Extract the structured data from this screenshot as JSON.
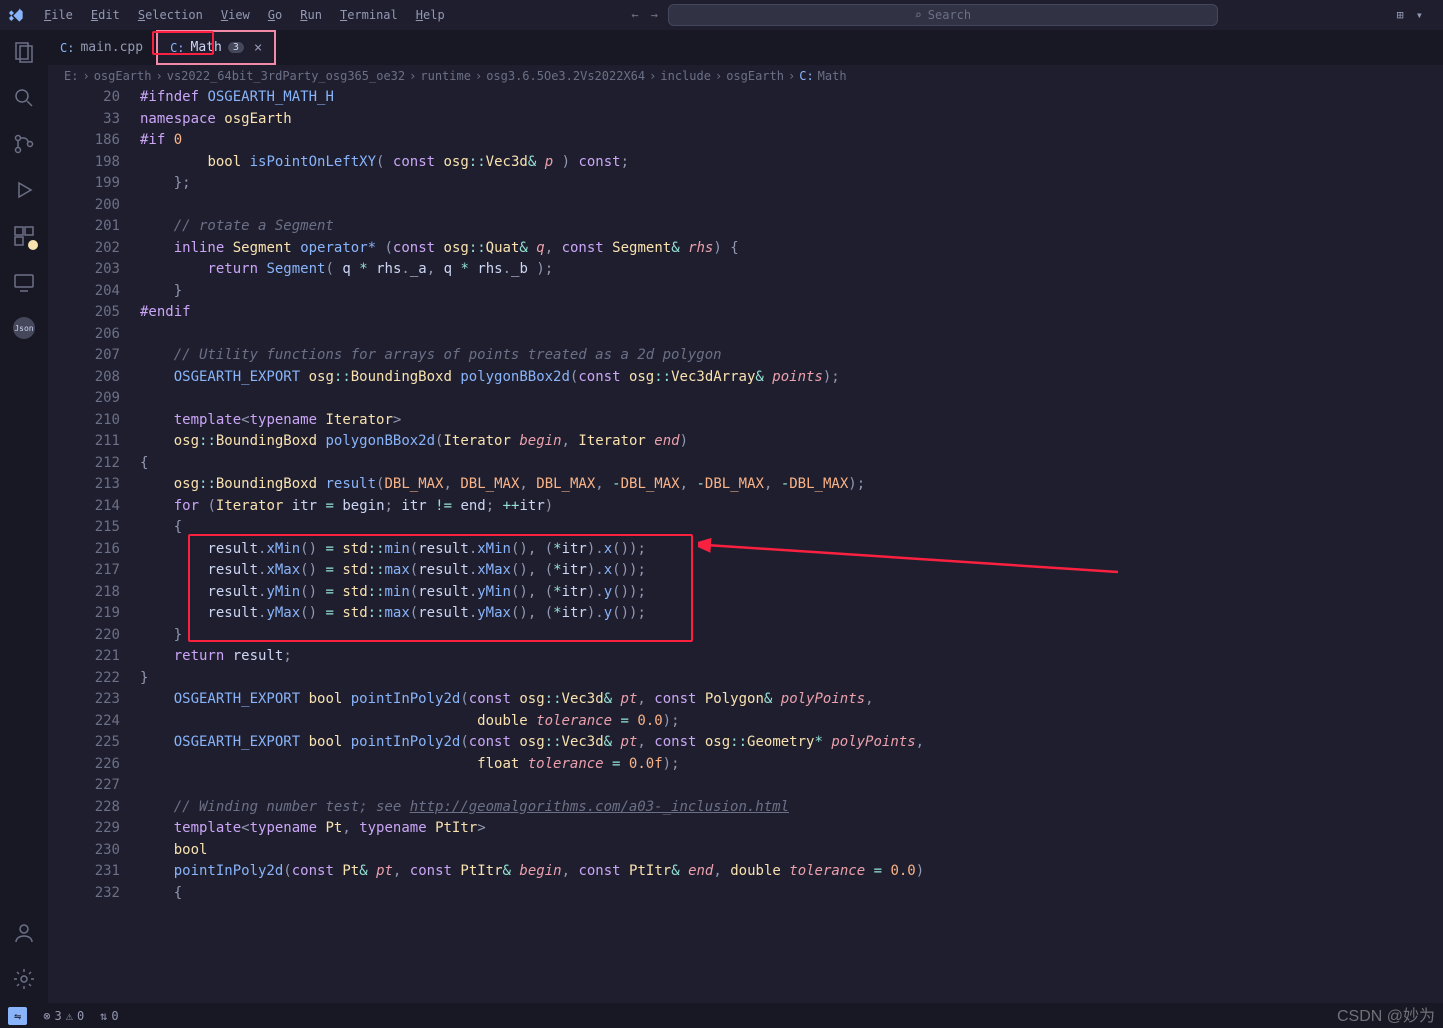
{
  "menu": [
    "File",
    "Edit",
    "Selection",
    "View",
    "Go",
    "Run",
    "Terminal",
    "Help"
  ],
  "search_placeholder": "Search",
  "tabs": [
    {
      "icon": "C:",
      "name": "main.cpp",
      "active": false
    },
    {
      "icon": "C:",
      "name": "Math",
      "active": true,
      "badge": "3"
    }
  ],
  "breadcrumb": [
    "E:",
    "osgEarth",
    "vs2022_64bit_3rdParty_osg365_oe32",
    "runtime",
    "osg3.6.5Oe3.2Vs2022X64",
    "include",
    "osgEarth",
    "Math"
  ],
  "breadcrumb_file_icon": "C:",
  "lines": [
    {
      "n": 20,
      "html": "<span class='c-macro'>#ifndef</span> <span class='c-macroname'>OSGEARTH_MATH_H</span>"
    },
    {
      "n": 33,
      "html": "<span class='c-keyword'>namespace</span> <span class='c-ns'>osgEarth</span>"
    },
    {
      "n": 186,
      "html": "<span class='c-macro'>#if</span> <span class='c-const'>0</span>"
    },
    {
      "n": 198,
      "html": "        <span class='c-type'>bool</span> <span class='c-func'>isPointOnLeftXY</span><span class='c-punct'>(</span> <span class='c-keyword'>const</span> <span class='c-ns'>osg</span><span class='c-op'>::</span><span class='c-type'>Vec3d</span><span class='c-op'>&amp;</span> <span class='c-param'>p</span> <span class='c-punct'>)</span> <span class='c-keyword'>const</span><span class='c-punct'>;</span>"
    },
    {
      "n": 199,
      "html": "    <span class='c-punct'>};</span>"
    },
    {
      "n": 200,
      "html": ""
    },
    {
      "n": 201,
      "html": "    <span class='c-comment'>// rotate a Segment</span>"
    },
    {
      "n": 202,
      "html": "    <span class='c-keyword'>inline</span> <span class='c-type'>Segment</span> <span class='c-func'>operator*</span> <span class='c-punct'>(</span><span class='c-keyword'>const</span> <span class='c-ns'>osg</span><span class='c-op'>::</span><span class='c-type'>Quat</span><span class='c-op'>&amp;</span> <span class='c-param'>q</span><span class='c-punct'>,</span> <span class='c-keyword'>const</span> <span class='c-type'>Segment</span><span class='c-op'>&amp;</span> <span class='c-param'>rhs</span><span class='c-punct'>) {</span>"
    },
    {
      "n": 203,
      "html": "        <span class='c-keyword'>return</span> <span class='c-func'>Segment</span><span class='c-punct'>(</span> <span class='c-var'>q</span> <span class='c-op'>*</span> <span class='c-var'>rhs</span><span class='c-punct'>.</span><span class='c-prop'>_a</span><span class='c-punct'>,</span> <span class='c-var'>q</span> <span class='c-op'>*</span> <span class='c-var'>rhs</span><span class='c-punct'>.</span><span class='c-prop'>_b</span> <span class='c-punct'>);</span>"
    },
    {
      "n": 204,
      "html": "    <span class='c-punct'>}</span>"
    },
    {
      "n": 205,
      "html": "<span class='c-macro'>#endif</span>"
    },
    {
      "n": 206,
      "html": ""
    },
    {
      "n": 207,
      "html": "    <span class='c-comment'>// Utility functions for arrays of points treated as a 2d polygon</span>"
    },
    {
      "n": 208,
      "html": "    <span class='c-macroname'>OSGEARTH_EXPORT</span> <span class='c-ns'>osg</span><span class='c-op'>::</span><span class='c-type'>BoundingBoxd</span> <span class='c-func'>polygonBBox2d</span><span class='c-punct'>(</span><span class='c-keyword'>const</span> <span class='c-ns'>osg</span><span class='c-op'>::</span><span class='c-type'>Vec3dArray</span><span class='c-op'>&amp;</span> <span class='c-param'>points</span><span class='c-punct'>);</span>"
    },
    {
      "n": 209,
      "html": ""
    },
    {
      "n": 210,
      "html": "    <span class='c-keyword'>template</span><span class='c-punct'>&lt;</span><span class='c-keyword'>typename</span> <span class='c-type'>Iterator</span><span class='c-punct'>&gt;</span>"
    },
    {
      "n": 211,
      "html": "    <span class='c-ns'>osg</span><span class='c-op'>::</span><span class='c-type'>BoundingBoxd</span> <span class='c-func'>polygonBBox2d</span><span class='c-punct'>(</span><span class='c-type'>Iterator</span> <span class='c-param'>begin</span><span class='c-punct'>,</span> <span class='c-type'>Iterator</span> <span class='c-param'>end</span><span class='c-punct'>)</span>"
    },
    {
      "n": 212,
      "html": "<span class='c-punct'>{</span>"
    },
    {
      "n": 213,
      "html": "    <span class='c-ns'>osg</span><span class='c-op'>::</span><span class='c-type'>BoundingBoxd</span> <span class='c-func'>result</span><span class='c-punct'>(</span><span class='c-const'>DBL_MAX</span><span class='c-punct'>,</span> <span class='c-const'>DBL_MAX</span><span class='c-punct'>,</span> <span class='c-const'>DBL_MAX</span><span class='c-punct'>,</span> <span class='c-op'>-</span><span class='c-const'>DBL_MAX</span><span class='c-punct'>,</span> <span class='c-op'>-</span><span class='c-const'>DBL_MAX</span><span class='c-punct'>,</span> <span class='c-op'>-</span><span class='c-const'>DBL_MAX</span><span class='c-punct'>);</span>"
    },
    {
      "n": 214,
      "html": "    <span class='c-keyword'>for</span> <span class='c-punct'>(</span><span class='c-type'>Iterator</span> <span class='c-var'>itr</span> <span class='c-op'>=</span> <span class='c-var'>begin</span><span class='c-punct'>;</span> <span class='c-var'>itr</span> <span class='c-op'>!=</span> <span class='c-var'>end</span><span class='c-punct'>;</span> <span class='c-op'>++</span><span class='c-var'>itr</span><span class='c-punct'>)</span>"
    },
    {
      "n": 215,
      "html": "    <span class='c-punct'>{</span>"
    },
    {
      "n": 216,
      "html": "        <span class='c-var'>result</span><span class='c-punct'>.</span><span class='c-func'>xMin</span><span class='c-punct'>()</span> <span class='c-op'>=</span> <span class='c-ns'>std</span><span class='c-op'>::</span><span class='c-func'>min</span><span class='c-punct'>(</span><span class='c-var'>result</span><span class='c-punct'>.</span><span class='c-func'>xMin</span><span class='c-punct'>(),</span> <span class='c-punct'>(</span><span class='c-op'>*</span><span class='c-var'>itr</span><span class='c-punct'>).</span><span class='c-func'>x</span><span class='c-punct'>());</span>"
    },
    {
      "n": 217,
      "html": "        <span class='c-var'>result</span><span class='c-punct'>.</span><span class='c-func'>xMax</span><span class='c-punct'>()</span> <span class='c-op'>=</span> <span class='c-ns'>std</span><span class='c-op'>::</span><span class='c-func'>max</span><span class='c-punct'>(</span><span class='c-var'>result</span><span class='c-punct'>.</span><span class='c-func'>xMax</span><span class='c-punct'>(),</span> <span class='c-punct'>(</span><span class='c-op'>*</span><span class='c-var'>itr</span><span class='c-punct'>).</span><span class='c-func'>x</span><span class='c-punct'>());</span>"
    },
    {
      "n": 218,
      "html": "        <span class='c-var'>result</span><span class='c-punct'>.</span><span class='c-func'>yMin</span><span class='c-punct'>()</span> <span class='c-op'>=</span> <span class='c-ns'>std</span><span class='c-op'>::</span><span class='c-func'>min</span><span class='c-punct'>(</span><span class='c-var'>result</span><span class='c-punct'>.</span><span class='c-func'>yMin</span><span class='c-punct'>(),</span> <span class='c-punct'>(</span><span class='c-op'>*</span><span class='c-var'>itr</span><span class='c-punct'>).</span><span class='c-func'>y</span><span class='c-punct'>());</span>"
    },
    {
      "n": 219,
      "html": "        <span class='c-var'>result</span><span class='c-punct'>.</span><span class='c-func'>yMax</span><span class='c-punct'>()</span> <span class='c-op'>=</span> <span class='c-ns'>std</span><span class='c-op'>::</span><span class='c-func'>max</span><span class='c-punct'>(</span><span class='c-var'>result</span><span class='c-punct'>.</span><span class='c-func'>yMax</span><span class='c-punct'>(),</span> <span class='c-punct'>(</span><span class='c-op'>*</span><span class='c-var'>itr</span><span class='c-punct'>).</span><span class='c-func'>y</span><span class='c-punct'>());</span>"
    },
    {
      "n": 220,
      "html": "    <span class='c-punct'>}</span>"
    },
    {
      "n": 221,
      "html": "    <span class='c-keyword'>return</span> <span class='c-var'>result</span><span class='c-punct'>;</span>"
    },
    {
      "n": 222,
      "html": "<span class='c-punct'>}</span>"
    },
    {
      "n": 223,
      "html": "    <span class='c-macroname'>OSGEARTH_EXPORT</span> <span class='c-type'>bool</span> <span class='c-func'>pointInPoly2d</span><span class='c-punct'>(</span><span class='c-keyword'>const</span> <span class='c-ns'>osg</span><span class='c-op'>::</span><span class='c-type'>Vec3d</span><span class='c-op'>&amp;</span> <span class='c-param'>pt</span><span class='c-punct'>,</span> <span class='c-keyword'>const</span> <span class='c-type'>Polygon</span><span class='c-op'>&amp;</span> <span class='c-param'>polyPoints</span><span class='c-punct'>,</span>"
    },
    {
      "n": 224,
      "html": "                                        <span class='c-type'>double</span> <span class='c-param'>tolerance</span> <span class='c-op'>=</span> <span class='c-const'>0.0</span><span class='c-punct'>);</span>"
    },
    {
      "n": 225,
      "html": "    <span class='c-macroname'>OSGEARTH_EXPORT</span> <span class='c-type'>bool</span> <span class='c-func'>pointInPoly2d</span><span class='c-punct'>(</span><span class='c-keyword'>const</span> <span class='c-ns'>osg</span><span class='c-op'>::</span><span class='c-type'>Vec3d</span><span class='c-op'>&amp;</span> <span class='c-param'>pt</span><span class='c-punct'>,</span> <span class='c-keyword'>const</span> <span class='c-ns'>osg</span><span class='c-op'>::</span><span class='c-type'>Geometry</span><span class='c-op'>*</span> <span class='c-param'>polyPoints</span><span class='c-punct'>,</span>"
    },
    {
      "n": 226,
      "html": "                                        <span class='c-type'>float</span> <span class='c-param'>tolerance</span> <span class='c-op'>=</span> <span class='c-const'>0.0f</span><span class='c-punct'>);</span>"
    },
    {
      "n": 227,
      "html": ""
    },
    {
      "n": 228,
      "html": "    <span class='c-comment'>// Winding number test; see <u>http://geomalgorithms.com/a03-_inclusion.html</u></span>"
    },
    {
      "n": 229,
      "html": "    <span class='c-keyword'>template</span><span class='c-punct'>&lt;</span><span class='c-keyword'>typename</span> <span class='c-type'>Pt</span><span class='c-punct'>,</span> <span class='c-keyword'>typename</span> <span class='c-type'>PtItr</span><span class='c-punct'>&gt;</span>"
    },
    {
      "n": 230,
      "html": "    <span class='c-type'>bool</span>"
    },
    {
      "n": 231,
      "html": "    <span class='c-func'>pointInPoly2d</span><span class='c-punct'>(</span><span class='c-keyword'>const</span> <span class='c-type'>Pt</span><span class='c-op'>&amp;</span> <span class='c-param'>pt</span><span class='c-punct'>,</span> <span class='c-keyword'>const</span> <span class='c-type'>PtItr</span><span class='c-op'>&amp;</span> <span class='c-param'>begin</span><span class='c-punct'>,</span> <span class='c-keyword'>const</span> <span class='c-type'>PtItr</span><span class='c-op'>&amp;</span> <span class='c-param'>end</span><span class='c-punct'>,</span> <span class='c-type'>double</span> <span class='c-param'>tolerance</span> <span class='c-op'>=</span> <span class='c-const'>0.0</span><span class='c-punct'>)</span>"
    },
    {
      "n": 232,
      "html": "    <span class='c-punct'>{</span>"
    }
  ],
  "status": {
    "errors": "3",
    "warnings": "0",
    "ports": "0"
  },
  "watermark": "CSDN @妙为"
}
